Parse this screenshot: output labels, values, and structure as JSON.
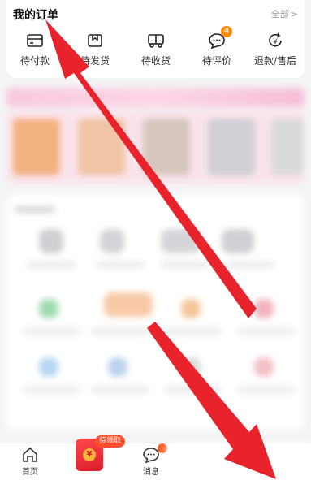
{
  "orders": {
    "title": "我的订单",
    "all_label": "全部",
    "all_chevron": ">",
    "items": [
      {
        "label": "待付款",
        "icon": "wallet-icon"
      },
      {
        "label": "待发货",
        "icon": "package-icon"
      },
      {
        "label": "待收货",
        "icon": "truck-icon"
      },
      {
        "label": "待评价",
        "icon": "comment-icon",
        "badge": "4"
      },
      {
        "label": "退款/售后",
        "icon": "refund-icon"
      }
    ]
  },
  "bottom_nav": {
    "home_label": "首页",
    "redpacket_tag": "待领取",
    "redpacket_coin": "¥",
    "message_label": "消息"
  },
  "colors": {
    "arrow": "#e8232c",
    "badge": "#ff8a00",
    "redpacket": "#e02530"
  }
}
